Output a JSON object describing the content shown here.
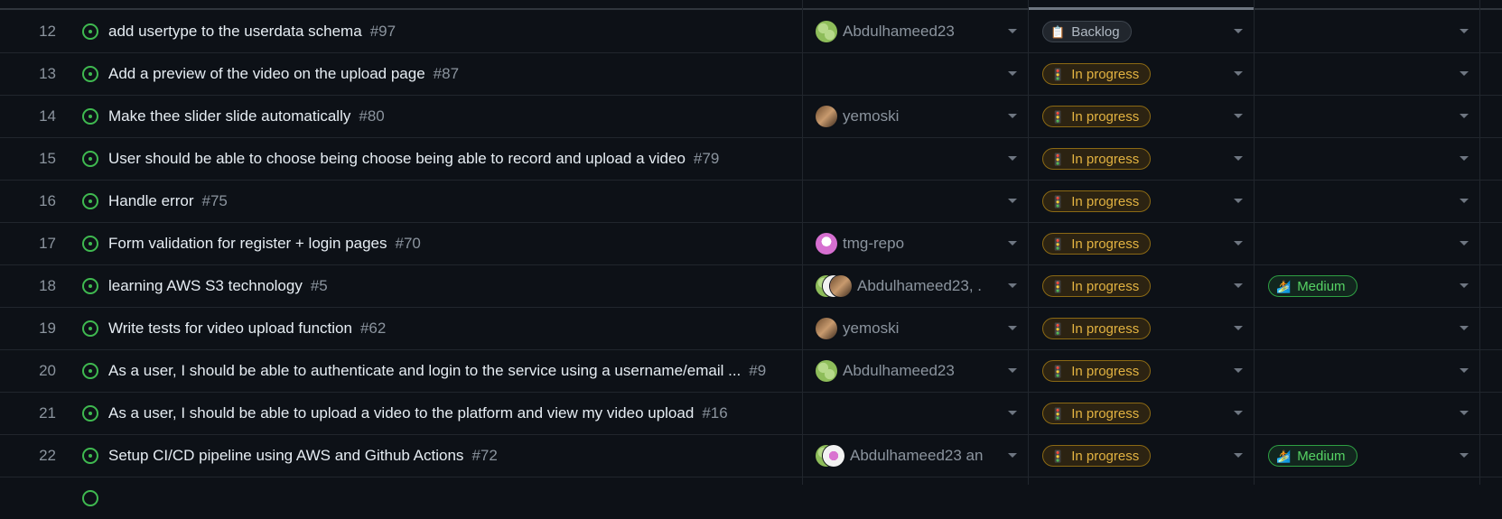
{
  "rows": [
    {
      "index": "12",
      "title": "add usertype to the userdata schema",
      "number": "#97",
      "assignee_text": "Abdulhameed23",
      "avatars": [
        "green"
      ],
      "status": {
        "icon": "📋",
        "label": "Backlog",
        "kind": "backlog"
      },
      "priority": null
    },
    {
      "index": "13",
      "title": "Add a preview of the video on the upload page",
      "number": "#87",
      "assignee_text": "",
      "avatars": [],
      "status": {
        "icon": "🚦",
        "label": "In progress",
        "kind": "inprog"
      },
      "priority": null
    },
    {
      "index": "14",
      "title": "Make thee slider slide automatically",
      "number": "#80",
      "assignee_text": "yemoski",
      "avatars": [
        "photo"
      ],
      "status": {
        "icon": "🚦",
        "label": "In progress",
        "kind": "inprog"
      },
      "priority": null
    },
    {
      "index": "15",
      "title": "User should be able to choose being choose being able to record and upload a video",
      "number": "#79",
      "assignee_text": "",
      "avatars": [],
      "status": {
        "icon": "🚦",
        "label": "In progress",
        "kind": "inprog"
      },
      "priority": null
    },
    {
      "index": "16",
      "title": "Handle error",
      "number": "#75",
      "assignee_text": "",
      "avatars": [],
      "status": {
        "icon": "🚦",
        "label": "In progress",
        "kind": "inprog"
      },
      "priority": null
    },
    {
      "index": "17",
      "title": "Form validation for register + login pages",
      "number": "#70",
      "assignee_text": "tmg-repo",
      "avatars": [
        "pink"
      ],
      "status": {
        "icon": "🚦",
        "label": "In progress",
        "kind": "inprog"
      },
      "priority": null
    },
    {
      "index": "18",
      "title": "learning AWS S3 technology",
      "number": "#5",
      "assignee_text": "Abdulhameed23, ...",
      "avatars": [
        "green",
        "white",
        "photo"
      ],
      "status": {
        "icon": "🚦",
        "label": "In progress",
        "kind": "inprog"
      },
      "priority": {
        "icon": "🏄",
        "label": "Medium"
      }
    },
    {
      "index": "19",
      "title": "Write tests for video upload function",
      "number": "#62",
      "assignee_text": "yemoski",
      "avatars": [
        "photo"
      ],
      "status": {
        "icon": "🚦",
        "label": "In progress",
        "kind": "inprog"
      },
      "priority": null
    },
    {
      "index": "20",
      "title": "As a user, I should be able to authenticate and login to the service using a username/email ...",
      "number": "#9",
      "assignee_text": "Abdulhameed23",
      "avatars": [
        "green"
      ],
      "status": {
        "icon": "🚦",
        "label": "In progress",
        "kind": "inprog"
      },
      "priority": null
    },
    {
      "index": "21",
      "title": "As a user, I should be able to upload a video to the platform and view my video upload",
      "number": "#16",
      "assignee_text": "",
      "avatars": [],
      "status": {
        "icon": "🚦",
        "label": "In progress",
        "kind": "inprog"
      },
      "priority": null
    },
    {
      "index": "22",
      "title": "Setup CI/CD pipeline using AWS and Github Actions",
      "number": "#72",
      "assignee_text": "Abdulhameed23 an...",
      "avatars": [
        "green",
        "white"
      ],
      "status": {
        "icon": "🚦",
        "label": "In progress",
        "kind": "inprog"
      },
      "priority": {
        "icon": "🏄",
        "label": "Medium"
      }
    }
  ],
  "colors": {
    "open_issue": "#3fb950",
    "in_progress": "#e3b341",
    "medium": "#56d364"
  }
}
